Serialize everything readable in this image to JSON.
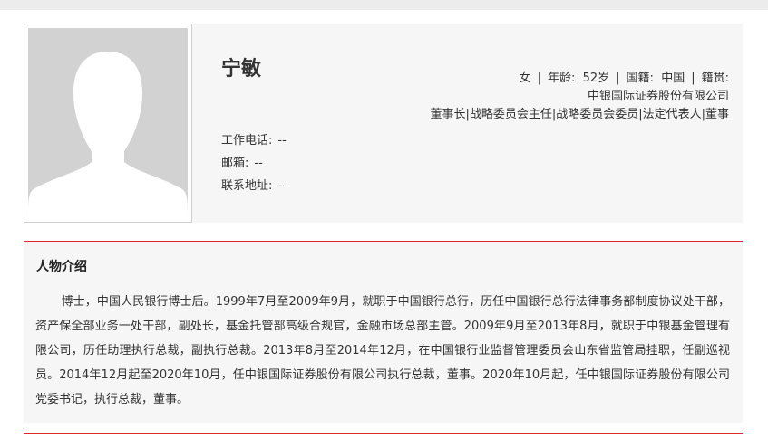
{
  "profile": {
    "name": "宁敏",
    "gender": "女",
    "age_label": "年龄:",
    "age": "52岁",
    "nationality_label": "国籍:",
    "nationality": "中国",
    "origin_label": "籍贯:",
    "origin": "",
    "company": "中银国际证券股份有限公司",
    "positions": "董事长|战略委员会主任|战略委员会委员|法定代表人|董事"
  },
  "contact": {
    "phone_label": "工作电话:",
    "phone": "--",
    "email_label": "邮箱:",
    "email": "--",
    "address_label": "联系地址:",
    "address": "--"
  },
  "bio": {
    "heading": "人物介绍",
    "text": "博士，中国人民银行博士后。1999年7月至2009年9月，就职于中国银行总行，历任中国银行总行法律事务部制度协议处干部，资产保全部业务一处干部，副处长，基金托管部高级合规官，金融市场总部主管。2009年9月至2013年8月，就职于中银基金管理有限公司，历任助理执行总裁，副执行总裁。2013年8月至2014年12月，在中国银行业监督管理委员会山东省监管局挂职，任副巡视员。2014年12月起至2020年10月，任中银国际证券股份有限公司执行总裁，董事。2020年10月起，任中银国际证券股份有限公司党委书记，执行总裁，董事。"
  },
  "colors": {
    "accent_line": "#d9292a",
    "panel_bg": "#f6f6f6",
    "avatar_bg": "#d2d2d2"
  },
  "icons": {
    "avatar": "person-silhouette-icon"
  }
}
